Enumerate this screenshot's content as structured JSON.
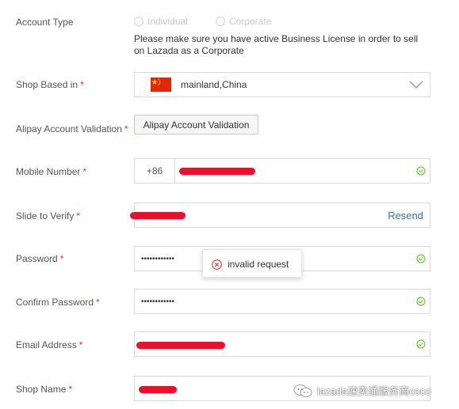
{
  "account_type": {
    "label": "Account Type",
    "options": [
      "Individual",
      "Corporate"
    ],
    "note": "Please make sure you have active Business License in order to sell on Lazada as a Corporate"
  },
  "shop_based": {
    "label": "Shop Based in",
    "value": "mainland,China"
  },
  "alipay": {
    "label": "Alipay Account Validation",
    "button": "Alipay Account Validation"
  },
  "mobile": {
    "label": "Mobile Number",
    "prefix": "+86"
  },
  "slide": {
    "label": "Slide to Verify",
    "resend": "Resend"
  },
  "password": {
    "label": "Password",
    "value": "••••••••••••"
  },
  "toast": {
    "text": "invalid request"
  },
  "confirm": {
    "label": "Confirm Password",
    "value": "••••••••••••"
  },
  "email": {
    "label": "Email Address"
  },
  "shop_name": {
    "label": "Shop Name"
  },
  "required_mark": "*",
  "watermark": {
    "text": "lazada速卖通服务商coco"
  },
  "colors": {
    "required": "#e3312f",
    "check": "#52c41a",
    "toast_error": "#e3312f",
    "redaction": "#e8112d"
  }
}
